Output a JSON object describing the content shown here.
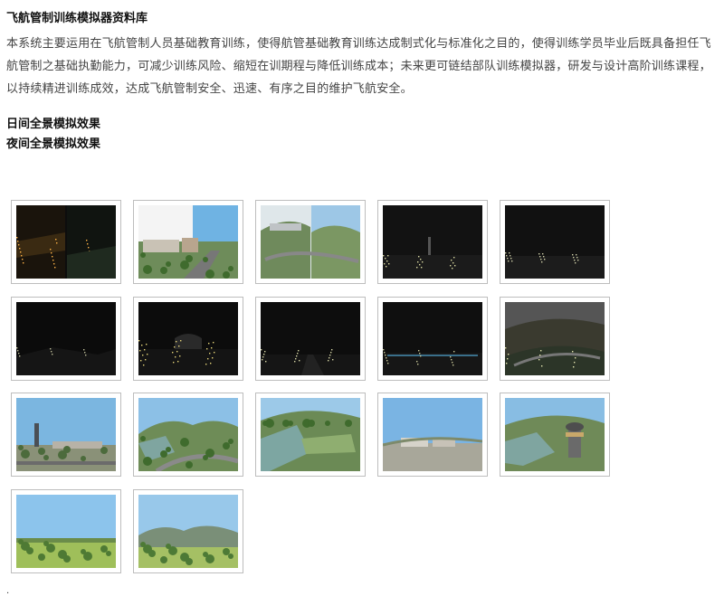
{
  "article": {
    "title": "飞航管制训练模拟器资料库",
    "intro": "本系统主要运用在飞航管制人员基础教育训练，使得航管基础教育训练达成制式化与标准化之目的，使得训练学员毕业后既具备担任飞航管制之基础执勤能力，可减少训练风险、缩短在训期程与降低训练成本；未来更可链结部队训练模拟器，研发与设计高阶训练课程，以持续精进训练成效，达成飞航管制安全、迅速、有序之目的维护飞航安全。",
    "day_label": "日间全景模拟效果",
    "night_label": "夜间全景模拟效果"
  },
  "gallery": {
    "rows": [
      [
        {
          "scene": "night-split",
          "name": "night-city-split-thumb"
        },
        {
          "scene": "day-split-sky",
          "name": "day-campus-split-thumb"
        },
        {
          "scene": "day-split-hill",
          "name": "day-hill-split-thumb"
        },
        {
          "scene": "night-tower",
          "name": "night-tower-thumb"
        },
        {
          "scene": "night-lights",
          "name": "night-lights-thumb"
        }
      ],
      [
        {
          "scene": "night-dark",
          "name": "night-dark-thumb"
        },
        {
          "scene": "night-buildings",
          "name": "night-buildings-thumb"
        },
        {
          "scene": "night-road",
          "name": "night-road-thumb"
        },
        {
          "scene": "night-runway",
          "name": "night-runway-thumb"
        },
        {
          "scene": "dusk-valley",
          "name": "dusk-valley-thumb"
        }
      ],
      [
        {
          "scene": "day-tower",
          "name": "day-tower-thumb"
        },
        {
          "scene": "day-hangar",
          "name": "day-hangar-thumb"
        },
        {
          "scene": "day-roof",
          "name": "day-roof-thumb"
        },
        {
          "scene": "day-apron",
          "name": "day-apron-thumb"
        },
        {
          "scene": "day-control-tower",
          "name": "day-control-tower-thumb"
        }
      ],
      [
        {
          "scene": "day-field",
          "name": "day-field-thumb"
        },
        {
          "scene": "day-mountain",
          "name": "day-mountain-thumb"
        }
      ]
    ]
  },
  "footer": {
    "mark": "."
  }
}
